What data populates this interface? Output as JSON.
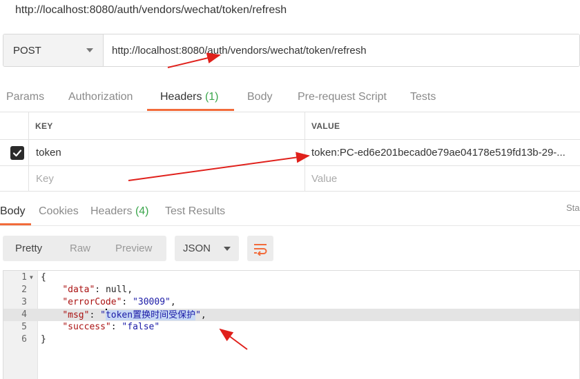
{
  "window": {
    "title_url": "http://localhost:8080/auth/vendors/wechat/token/refresh"
  },
  "request": {
    "method": "POST",
    "url": "http://localhost:8080/auth/vendors/wechat/token/refresh"
  },
  "request_tabs": [
    {
      "label": "Params"
    },
    {
      "label": "Authorization"
    },
    {
      "label": "Headers",
      "count": "(1)",
      "active": true
    },
    {
      "label": "Body"
    },
    {
      "label": "Pre-request Script"
    },
    {
      "label": "Tests"
    }
  ],
  "headers_table": {
    "col_key": "KEY",
    "col_value": "VALUE",
    "rows": [
      {
        "checked": true,
        "key": "token",
        "value": "token:PC-ed6e201becad0e79ae04178e519fd13b-29-..."
      }
    ],
    "new_row": {
      "key_placeholder": "Key",
      "value_placeholder": "Value"
    }
  },
  "response_tabs": [
    {
      "label": "Body",
      "active": true
    },
    {
      "label": "Cookies"
    },
    {
      "label": "Headers",
      "count": "(4)"
    },
    {
      "label": "Test Results"
    }
  ],
  "status_clip": "Sta",
  "view_modes": {
    "pretty": "Pretty",
    "raw": "Raw",
    "preview": "Preview"
  },
  "format_select": "JSON",
  "code_lines": [
    {
      "n": "1",
      "text": "{"
    },
    {
      "n": "2",
      "key": "\"data\"",
      "sep": ": ",
      "val": "null",
      "end": ","
    },
    {
      "n": "3",
      "key": "\"errorCode\"",
      "sep": ": ",
      "val": "\"30009\"",
      "end": ","
    },
    {
      "n": "4",
      "key": "\"msg\"",
      "sep": ": ",
      "q": "\"",
      "sel": "token置换时间受保护",
      "q2": "\"",
      "end": ","
    },
    {
      "n": "5",
      "key": "\"success\"",
      "sep": ": ",
      "val": "\"false\"",
      "end": ""
    },
    {
      "n": "6",
      "text": "}"
    }
  ],
  "colors": {
    "accent": "#f26b3a",
    "count_green": "#3aa64b",
    "annotation_red": "#e0201b"
  },
  "icons": {
    "checkbox": "check-icon",
    "wrap": "wrap-lines-icon",
    "dropdown": "chevron-down-icon"
  }
}
